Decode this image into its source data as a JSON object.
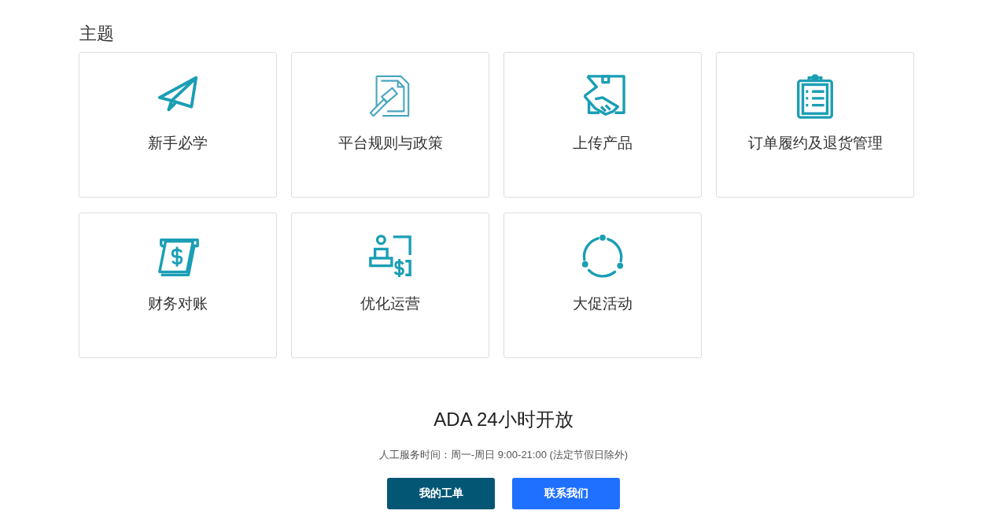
{
  "section_title": "主题",
  "topics": [
    {
      "label": "新手必学",
      "kind": "plane"
    },
    {
      "label": "平台规则与政策",
      "kind": "gavel"
    },
    {
      "label": "上传产品",
      "kind": "box"
    },
    {
      "label": "订单履约及退货管理",
      "kind": "clipboard"
    },
    {
      "label": "财务对账",
      "kind": "bill"
    },
    {
      "label": "优化运营",
      "kind": "person"
    },
    {
      "label": "大促活动",
      "kind": "cycle"
    }
  ],
  "support": {
    "title": "ADA 24小时开放",
    "hours": "人工服务时间：周一-周日 9:00-21:00 (法定节假日除外)",
    "buttons": [
      {
        "label": "我的工单",
        "kind": "dark"
      },
      {
        "label": "联系我们",
        "kind": "primary"
      }
    ]
  }
}
